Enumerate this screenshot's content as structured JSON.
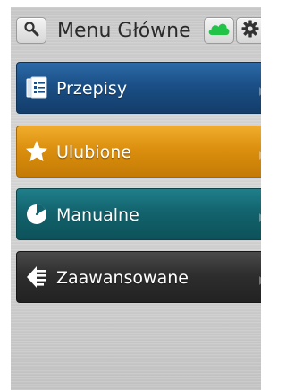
{
  "header": {
    "title": "Menu Główne",
    "search_icon": "search-icon",
    "cloud_icon": "cloud-icon",
    "settings_icon": "gear-icon"
  },
  "menu": {
    "items": [
      {
        "label": "Przepisy",
        "icon": "recipes-list-icon",
        "color": "#1a4f86"
      },
      {
        "label": "Ulubione",
        "icon": "star-icon",
        "color": "#dc8f0e"
      },
      {
        "label": "Manualne",
        "icon": "timer-icon",
        "color": "#12636d"
      },
      {
        "label": "Zaawansowane",
        "icon": "advanced-icon",
        "color": "#2e2e2e"
      }
    ]
  },
  "colors": {
    "cloud": "#21c447"
  }
}
